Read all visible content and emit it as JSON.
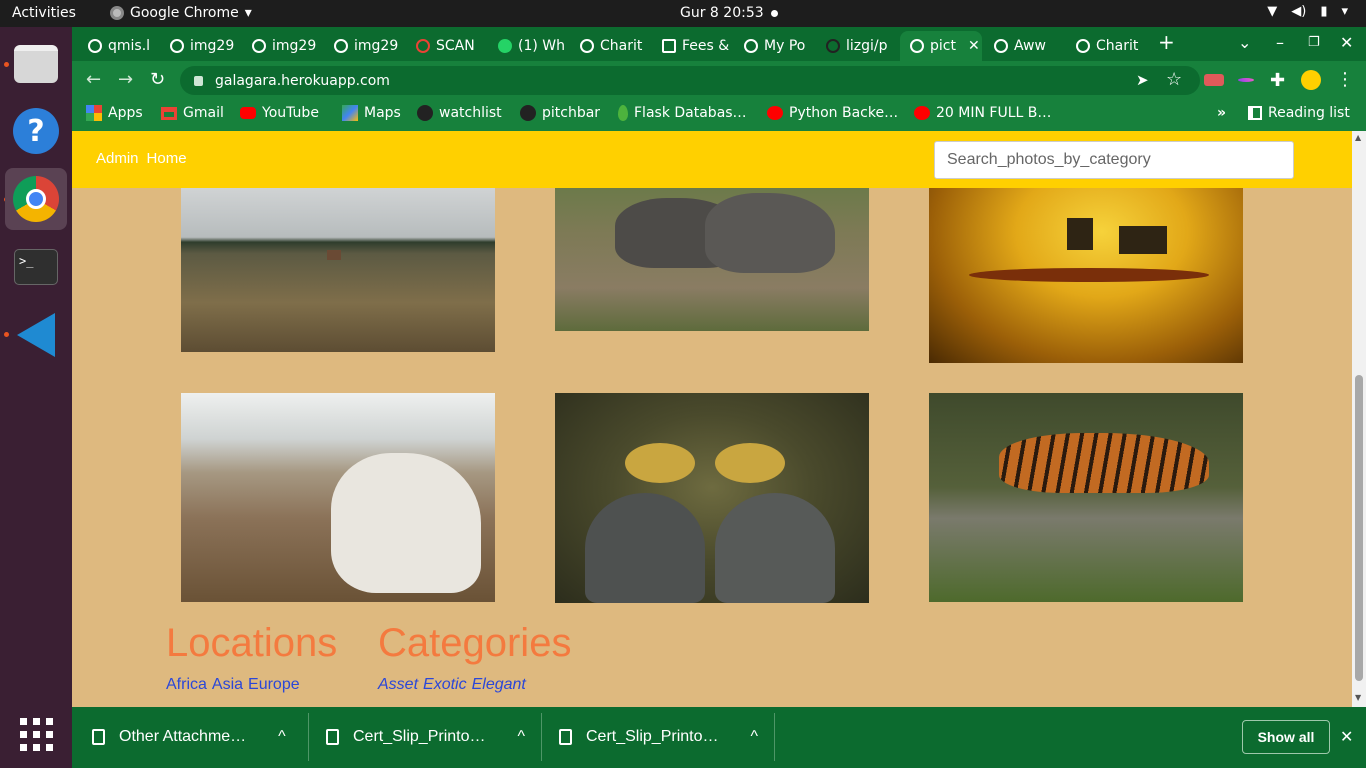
{
  "system": {
    "activities": "Activities",
    "app_name": "Google Chrome",
    "clock": "Gur 8  20:53",
    "status_icons": [
      "wifi-icon",
      "volume-icon",
      "battery-icon",
      "power-menu-icon"
    ]
  },
  "dock": {
    "apps": [
      "files",
      "help",
      "chrome",
      "terminal",
      "vscode",
      "show-applications"
    ],
    "terminal_prompt": ">_"
  },
  "tabs": [
    {
      "title": "qmis.l"
    },
    {
      "title": "img29"
    },
    {
      "title": "img29"
    },
    {
      "title": "img29"
    },
    {
      "title": "SCAN"
    },
    {
      "title": "(1) Wh"
    },
    {
      "title": "Charit"
    },
    {
      "title": "Fees &"
    },
    {
      "title": "My Po"
    },
    {
      "title": "lizgi/p"
    },
    {
      "title": "pict",
      "active": true
    },
    {
      "title": "Aww"
    },
    {
      "title": "Charit"
    }
  ],
  "browser": {
    "url": "galagara.herokuapp.com",
    "new_tab": "+",
    "close_tab": "✕"
  },
  "bookmarks": [
    {
      "label": "Apps"
    },
    {
      "label": "Gmail"
    },
    {
      "label": "YouTube"
    },
    {
      "label": "Maps"
    },
    {
      "label": "watchlist"
    },
    {
      "label": "pitchbar"
    },
    {
      "label": "Flask Databas…"
    },
    {
      "label": "Python Backe…"
    },
    {
      "label": "20 MIN FULL B…"
    }
  ],
  "reading_list": "Reading list",
  "overflow": "»",
  "page": {
    "nav": {
      "admin": "Admin",
      "home": "Home"
    },
    "search_placeholder": "Search_photos_by_category",
    "locations": {
      "title": "Locations",
      "items": [
        "Africa",
        "Asia",
        "Europe"
      ]
    },
    "categories": {
      "title": "Categories",
      "items": [
        "Asset",
        "Exotic",
        "Elegant"
      ]
    },
    "photos": [
      "field-with-cow",
      "two-rhinos",
      "elephants-at-sunset",
      "white-horse",
      "crowned-cranes",
      "tiger-on-rock"
    ]
  },
  "downloads": {
    "items": [
      {
        "name": "Other Attachme…"
      },
      {
        "name": "Cert_Slip_Printo…"
      },
      {
        "name": "Cert_Slip_Printo…"
      }
    ],
    "show_all": "Show all",
    "chevron": "^"
  }
}
